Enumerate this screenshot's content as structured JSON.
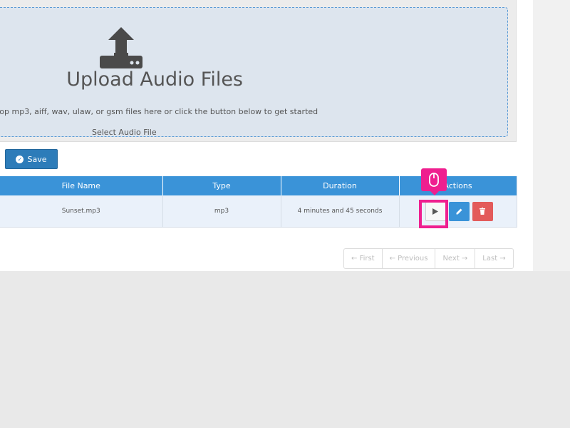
{
  "upload": {
    "title": "Upload Audio Files",
    "hint": "rop mp3, aiff, wav, ulaw, or gsm files here or click the button below to get started",
    "select_label": "Select Audio File"
  },
  "toolbar": {
    "save_label": "Save"
  },
  "table": {
    "headers": [
      "File Name",
      "Type",
      "Duration",
      "Actions"
    ],
    "rows": [
      {
        "file_name": "Sunset.mp3",
        "type": "mp3",
        "duration": "4 minutes and 45 seconds"
      }
    ]
  },
  "icons": {
    "upload": "upload-icon",
    "save": "check-circle-icon",
    "play": "play-icon",
    "edit": "pencil-icon",
    "delete": "trash-icon",
    "cursor": "mouse-icon"
  },
  "colors": {
    "header": "#3a93d8",
    "save": "#2d7cb9",
    "delete": "#e35b5b",
    "highlight": "#ef1f8f",
    "dropzone": "#dde5ee"
  },
  "pagination": {
    "first": "← First",
    "previous": "← Previous",
    "next": "Next →",
    "last": "Last →"
  }
}
